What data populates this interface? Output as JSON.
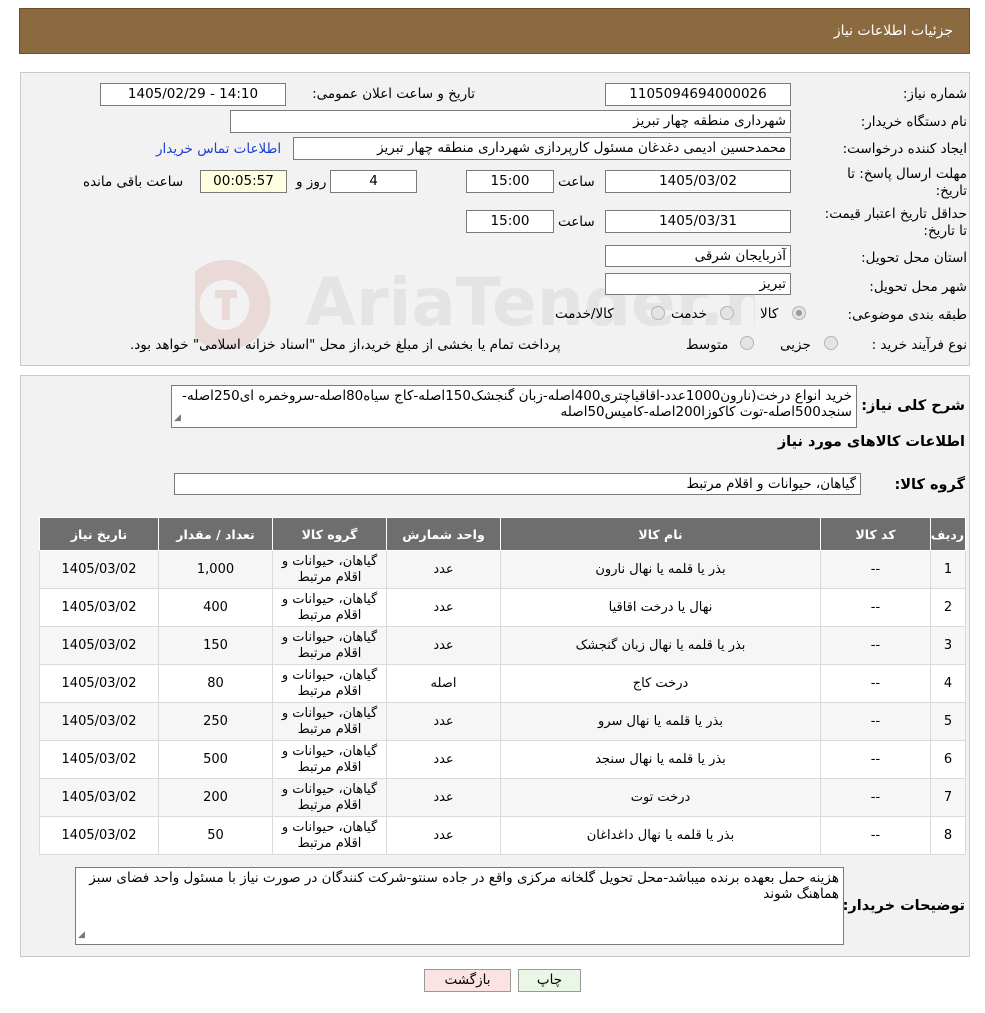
{
  "header": {
    "title": "جزئیات اطلاعات نیاز"
  },
  "form": {
    "need_number_label": "شماره نیاز:",
    "need_number": "1105094694000026",
    "announce_label": "تاریخ و ساعت اعلان عمومی:",
    "announce_value": "1405/02/29 - 14:10",
    "buyer_org_label": "نام دستگاه خریدار:",
    "buyer_org": "شهرداری منطقه چهار تبریز",
    "requester_label": "ایجاد کننده درخواست:",
    "requester": "محمدحسین ادیمی دغدغان مسئول کارپردازی شهرداری منطقه چهار تبریز",
    "contact_link": "اطلاعات تماس خریدار",
    "deadline_label": "مهلت ارسال پاسخ: تا تاریخ:",
    "deadline_date": "1405/03/02",
    "time_label": "ساعت",
    "deadline_time": "15:00",
    "days_value": "4",
    "days_label": "روز و",
    "remaining_time": "00:05:57",
    "remaining_label": "ساعت باقی مانده",
    "validity_label": "حداقل تاریخ اعتبار قیمت: تا تاریخ:",
    "validity_date": "1405/03/31",
    "validity_time": "15:00",
    "province_label": "استان محل تحویل:",
    "province": "آذربایجان شرقی",
    "city_label": "شهر محل تحویل:",
    "city": "تبریز",
    "category_label": "طبقه بندی موضوعی:",
    "category_options": [
      "کالا",
      "خدمت",
      "کالا/خدمت"
    ],
    "process_label": "نوع فرآیند خرید :",
    "process_options": [
      "جزیی",
      "متوسط"
    ],
    "process_note": "پرداخت تمام یا بخشی از مبلغ خرید،از محل \"اسناد خزانه اسلامی\" خواهد بود."
  },
  "description": {
    "label": "شرح کلی نیاز:",
    "text": "خرید انواع درخت(نارون1000عدد-اقاقیاچتری400اصله-زبان گنجشک150اصله-کاج سیاه80اصله-سروخمره ای250اصله-سنجد500اصله-توت کاکوزا200اصله-کامیس50اصله"
  },
  "goods": {
    "section_title": "اطلاعات کالاهای مورد نیاز",
    "group_label": "گروه کالا:",
    "group_value": "گیاهان، حیوانات و اقلام مرتبط",
    "columns": [
      "ردیف",
      "کد کالا",
      "نام کالا",
      "واحد شمارش",
      "گروه کالا",
      "تعداد / مقدار",
      "تاریخ نیاز"
    ],
    "rows": [
      [
        "1",
        "--",
        "بذر یا قلمه یا نهال نارون",
        "عدد",
        "گیاهان، حیوانات و اقلام مرتبط",
        "1,000",
        "1405/03/02"
      ],
      [
        "2",
        "--",
        "نهال یا درخت اقاقیا",
        "عدد",
        "گیاهان، حیوانات و اقلام مرتبط",
        "400",
        "1405/03/02"
      ],
      [
        "3",
        "--",
        "بذر یا قلمه یا نهال زبان گنجشک",
        "عدد",
        "گیاهان، حیوانات و اقلام مرتبط",
        "150",
        "1405/03/02"
      ],
      [
        "4",
        "--",
        "درخت کاج",
        "اصله",
        "گیاهان، حیوانات و اقلام مرتبط",
        "80",
        "1405/03/02"
      ],
      [
        "5",
        "--",
        "بذر یا قلمه یا نهال سرو",
        "عدد",
        "گیاهان، حیوانات و اقلام مرتبط",
        "250",
        "1405/03/02"
      ],
      [
        "6",
        "--",
        "بذر یا قلمه یا نهال سنجد",
        "عدد",
        "گیاهان، حیوانات و اقلام مرتبط",
        "500",
        "1405/03/02"
      ],
      [
        "7",
        "--",
        "درخت توت",
        "عدد",
        "گیاهان، حیوانات و اقلام مرتبط",
        "200",
        "1405/03/02"
      ],
      [
        "8",
        "--",
        "بذر یا قلمه یا نهال داغداغان",
        "عدد",
        "گیاهان، حیوانات و اقلام مرتبط",
        "50",
        "1405/03/02"
      ]
    ]
  },
  "buyer_notes": {
    "label": "توضیحات خریدار:",
    "text": "هزینه حمل بعهده برنده میباشد-محل تحویل گلخانه مرکزی واقع در جاده سنتو-شرکت کنندگان در صورت نیاز با مسئول واحد فضای سبز هماهنگ شوند"
  },
  "buttons": {
    "print": "چاپ",
    "back": "بازگشت"
  },
  "watermark": {
    "text": "AriaTender.neT"
  }
}
